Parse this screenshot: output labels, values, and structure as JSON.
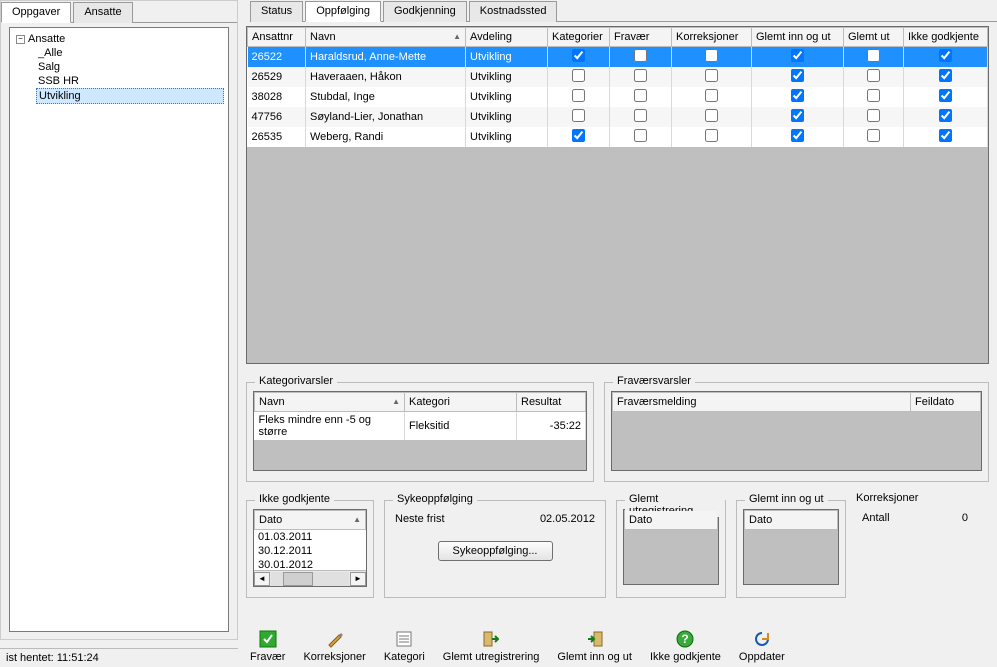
{
  "left_tabs": {
    "oppgaver": "Oppgaver",
    "ansatte": "Ansatte"
  },
  "tree": {
    "root": "Ansatte",
    "items": [
      "_Alle",
      "Salg",
      "SSB HR",
      "Utvikling"
    ],
    "selected_index": 3
  },
  "right_tabs": {
    "status": "Status",
    "oppfolging": "Oppfølging",
    "godkjenning": "Godkjenning",
    "kostnadssted": "Kostnadssted",
    "active": "oppfolging"
  },
  "main_grid": {
    "cols": {
      "ansattnr": "Ansattnr",
      "navn": "Navn",
      "avdeling": "Avdeling",
      "kategorier": "Kategorier",
      "fravaer": "Fravær",
      "korreksjoner": "Korreksjoner",
      "glemt_inn_ut": "Glemt inn og ut",
      "glemt_ut": "Glemt ut",
      "ikke_godkjente": "Ikke godkjente"
    },
    "rows": [
      {
        "ansattnr": "26522",
        "navn": "Haraldsrud, Anne-Mette",
        "avdeling": "Utvikling",
        "kategorier": true,
        "fravaer": false,
        "korreksjoner": false,
        "glemt_inn_ut": true,
        "glemt_ut": false,
        "ikke_godkjente": true,
        "selected": true
      },
      {
        "ansattnr": "26529",
        "navn": "Haveraaen, Håkon",
        "avdeling": "Utvikling",
        "kategorier": false,
        "fravaer": false,
        "korreksjoner": false,
        "glemt_inn_ut": true,
        "glemt_ut": false,
        "ikke_godkjente": true
      },
      {
        "ansattnr": "38028",
        "navn": "Stubdal, Inge",
        "avdeling": "Utvikling",
        "kategorier": false,
        "fravaer": false,
        "korreksjoner": false,
        "glemt_inn_ut": true,
        "glemt_ut": false,
        "ikke_godkjente": true
      },
      {
        "ansattnr": "47756",
        "navn": "Søyland-Lier, Jonathan",
        "avdeling": "Utvikling",
        "kategorier": false,
        "fravaer": false,
        "korreksjoner": false,
        "glemt_inn_ut": true,
        "glemt_ut": false,
        "ikke_godkjente": true
      },
      {
        "ansattnr": "26535",
        "navn": "Weberg, Randi",
        "avdeling": "Utvikling",
        "kategorier": true,
        "fravaer": false,
        "korreksjoner": false,
        "glemt_inn_ut": true,
        "glemt_ut": false,
        "ikke_godkjente": true
      }
    ]
  },
  "kategorivarsler": {
    "title": "Kategorivarsler",
    "cols": {
      "navn": "Navn",
      "kategori": "Kategori",
      "resultat": "Resultat"
    },
    "rows": [
      {
        "navn": "Fleks mindre enn -5 og større",
        "kategori": "Fleksitid",
        "resultat": "-35:22"
      }
    ]
  },
  "fravaersvarsler": {
    "title": "Fraværsvarsler",
    "cols": {
      "melding": "Fraværsmelding",
      "feildato": "Feildato"
    }
  },
  "ikke_godkjente": {
    "title": "Ikke godkjente",
    "col": "Dato",
    "dates": [
      "01.03.2011",
      "30.12.2011",
      "30.01.2012"
    ]
  },
  "sykeoppfolging": {
    "title": "Sykeoppfølging",
    "label": "Neste frist",
    "value": "02.05.2012",
    "button": "Sykeoppfølging..."
  },
  "glemt_utreg": {
    "title": "Glemt utregistrering",
    "col": "Dato"
  },
  "glemt_innut": {
    "title": "Glemt inn og ut",
    "col": "Dato"
  },
  "korreksjoner": {
    "title": "Korreksjoner",
    "label": "Antall",
    "value": "0"
  },
  "toolbar": {
    "fravaer": "Fravær",
    "korreksjoner": "Korreksjoner",
    "kategori": "Kategori",
    "glemt_utreg": "Glemt utregistrering",
    "glemt_innut": "Glemt inn og ut",
    "ikke_godkjente": "Ikke godkjente",
    "oppdater": "Oppdater"
  },
  "status_bar": "ist hentet: 11:51:24"
}
